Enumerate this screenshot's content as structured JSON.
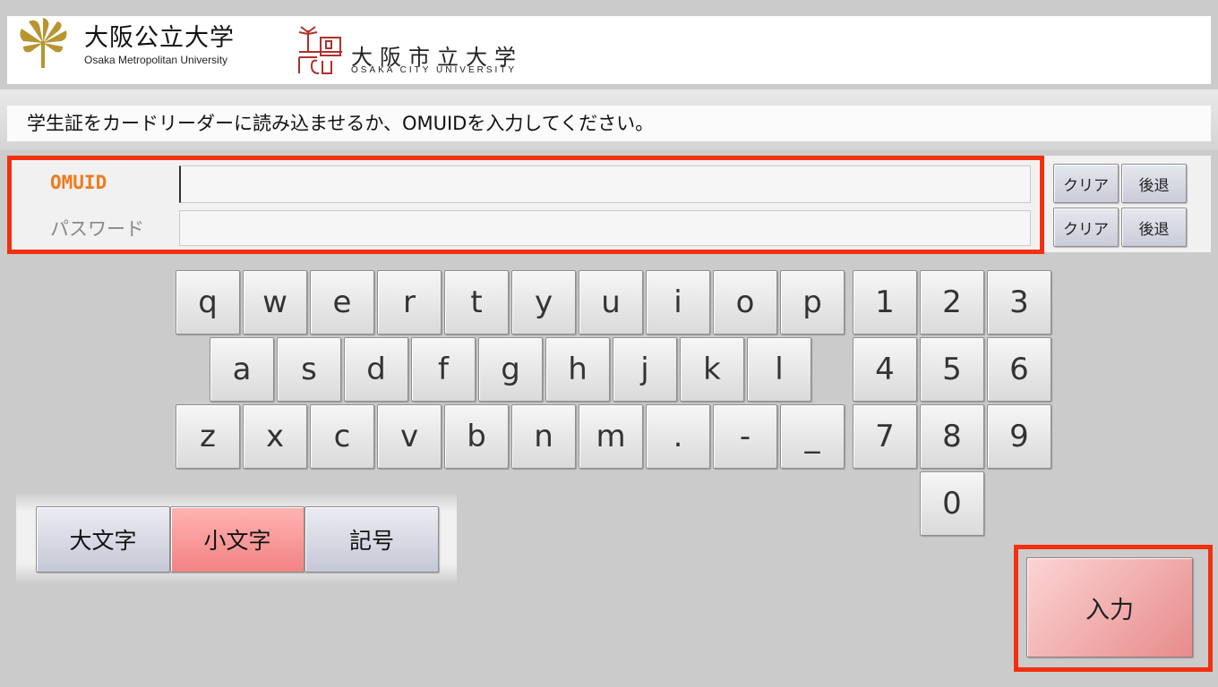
{
  "header": {
    "omu_logo": {
      "title": "大阪公立大学",
      "subtitle": "Osaka Metropolitan University"
    },
    "ocu_logo": {
      "title": "大阪市立大学",
      "subtitle": "OSAKA CITY UNIVERSITY"
    }
  },
  "instruction": "学生証をカードリーダーに読み込ませるか、OMUIDを入力してください。",
  "form": {
    "omuid_label": "OMUID",
    "omuid_value": "",
    "password_label": "パスワード",
    "password_value": "",
    "clear_label": "クリア",
    "back_label": "後退"
  },
  "keyboard": {
    "row1": [
      "q",
      "w",
      "e",
      "r",
      "t",
      "y",
      "u",
      "i",
      "o",
      "p"
    ],
    "row2": [
      "a",
      "s",
      "d",
      "f",
      "g",
      "h",
      "j",
      "k",
      "l"
    ],
    "row3": [
      "z",
      "x",
      "c",
      "v",
      "b",
      "n",
      "m",
      ".",
      "-",
      "_"
    ],
    "numpad": [
      "1",
      "2",
      "3",
      "4",
      "5",
      "6",
      "7",
      "8",
      "9",
      "0"
    ]
  },
  "modes": {
    "upper": "大文字",
    "lower": "小文字",
    "symbol": "記号",
    "active": "lower"
  },
  "enter_label": "入力",
  "colors": {
    "highlight_border": "#f2300f",
    "active_mode": "#f28383",
    "omuid_label": "#ef7a1b"
  }
}
